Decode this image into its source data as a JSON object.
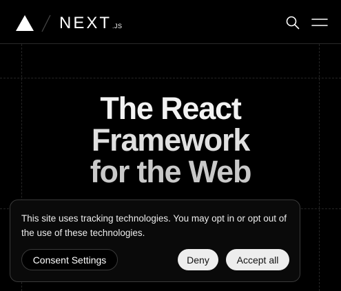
{
  "header": {
    "brand": {
      "wordmark": "NEXT",
      "suffix": ".JS"
    },
    "icons": {
      "vercel": "vercel-triangle-icon",
      "search": "search-icon",
      "menu": "menu-icon"
    }
  },
  "hero": {
    "line1": "The React",
    "line2": "Framework",
    "line3": "for the Web"
  },
  "consent": {
    "message": "This site uses tracking technologies. You may opt in or opt out of the use of these technologies.",
    "settings_label": "Consent Settings",
    "deny_label": "Deny",
    "accept_label": "Accept all"
  },
  "colors": {
    "background": "#000000",
    "text": "#ffffff",
    "button_light": "#ededed",
    "border": "#3a3a3a"
  }
}
